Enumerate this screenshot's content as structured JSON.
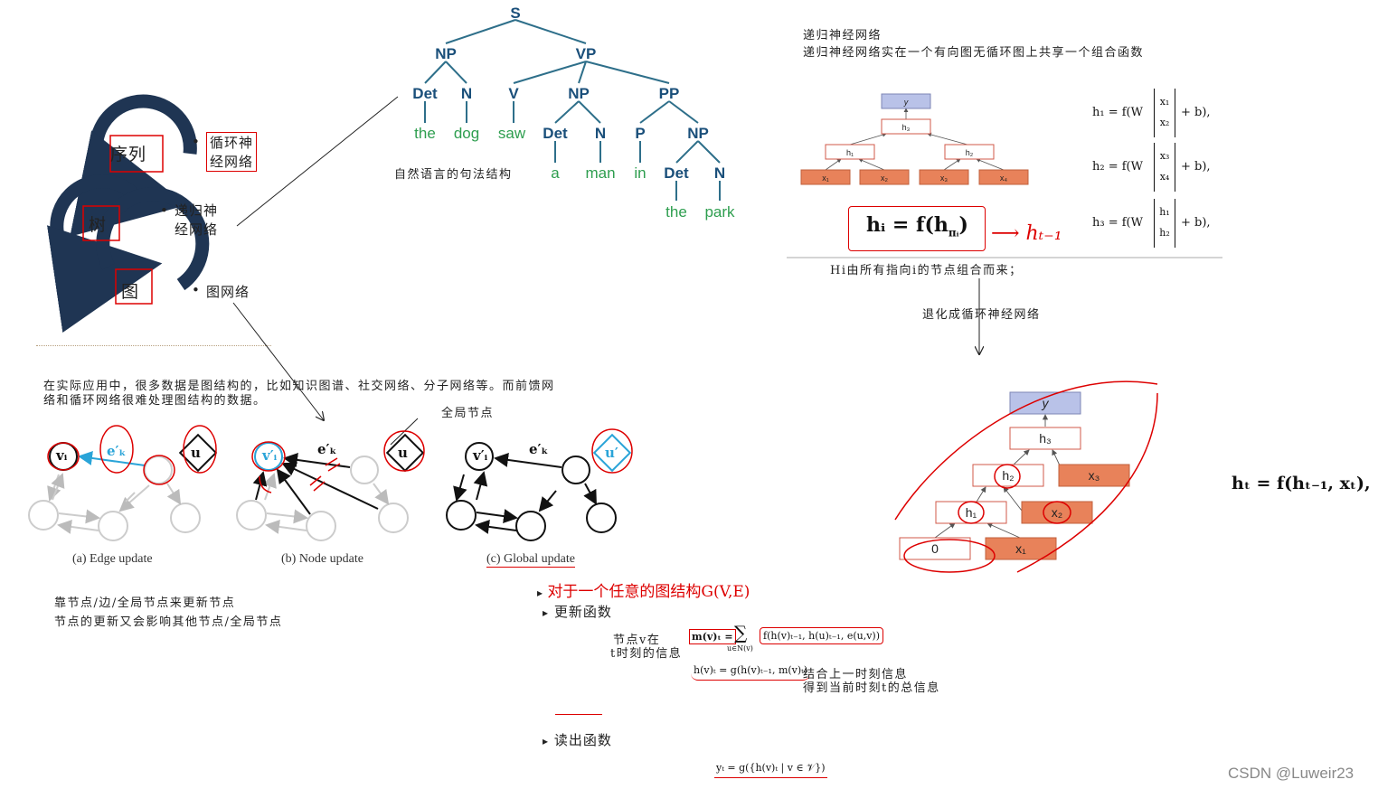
{
  "left_graphic": {
    "circle_labels": [
      "序列",
      "树",
      "图"
    ],
    "bullets": [
      {
        "label_l1": "循环神",
        "label_l2": "经网络"
      },
      {
        "label_l1": "递归神",
        "label_l2": "经网络"
      },
      {
        "label_l1": "图网络",
        "label_l2": ""
      }
    ],
    "dot": "•"
  },
  "parse_tree": {
    "nodes": [
      "S",
      "NP",
      "VP",
      "Det",
      "N",
      "V",
      "NP",
      "PP",
      "Det",
      "N",
      "P",
      "NP",
      "Det",
      "N"
    ],
    "words": [
      "the",
      "dog",
      "saw",
      "a",
      "man",
      "in",
      "the",
      "park"
    ],
    "caption": "自然语言的句法结构"
  },
  "recursive_nn": {
    "title": "递归神经网络",
    "desc": "递归神经网络实在一个有向图无循环图上共享一个组合函数",
    "node_labels": {
      "y": "y",
      "h3": "h₃",
      "h1": "h₁",
      "h2": "h₂",
      "x1": "x₁",
      "x2": "x₂",
      "x3": "x₃",
      "x4": "x₄"
    },
    "eq_lhs": [
      "h₁ = f(W",
      "h₂ = f(W",
      "h₃ = f(W"
    ],
    "eq_rhs": "+ b),",
    "vec_top": [
      "x₁",
      "x₃",
      "h₁"
    ],
    "vec_bot": [
      "x₂",
      "x₄",
      "h₂"
    ],
    "eq_main": "hᵢ = f(h",
    "eq_main_sub": "πᵢ",
    "eq_main_close": ")",
    "handwritten": "⟶ hₜ₋₁",
    "note": "Hi由所有指向i的节点组合而来；",
    "arrow_note": "退化成循环神经网络"
  },
  "rnn": {
    "node_labels": {
      "y": "y",
      "h3": "h₃",
      "h2": "h₂",
      "x3": "x₃",
      "h1": "h₁",
      "x2": "x₂",
      "zero": "0",
      "x1": "x₁"
    },
    "equation": "hₜ = f(hₜ₋₁, xₜ),"
  },
  "graph_text": {
    "intro_l1": "在实际应用中，很多数据是图结构的，比如知识图谱、社交网络、分子网络等。而前馈网",
    "intro_l2": "络和循环网络很难处理图结构的数据。",
    "global_node_note": "全局节点",
    "captions": [
      "(a) Edge update",
      "(b) Node update",
      "(c) Global update"
    ],
    "labels": {
      "vi": "vᵢ",
      "ek": "e′ₖ",
      "u": "u",
      "vi_p": "v′ᵢ",
      "u_p": "u′"
    },
    "note_l1": "靠节点/边/全局节点来更新节点",
    "note_l2": "节点的更新又会影响其他节点/全局节点"
  },
  "formulas": {
    "heading": "对于一个任意的图结构G(V,E)",
    "update_title": "更新函数",
    "node_info_l1": "节点v在",
    "node_info_l2": "t时刻的信息",
    "m_eq": "m(v)ₜ =",
    "sum": "∑",
    "sum_sub": "u∈N(v)",
    "f_args": "f(h(v)ₜ₋₁, h(u)ₜ₋₁, e(u,v))",
    "h_eq": "h(v)ₜ = g(h(v)ₜ₋₁, m(v)ₜ)",
    "combine_l1": "结合上一时刻信息",
    "combine_l2": "得到当前时刻t的总信息",
    "readout_title": "读出函数",
    "y_eq": "yₜ = g({h(v)ₜ | v ∈ 𝒱})",
    "marker": "▸"
  },
  "watermark": "CSDN @Luweir23",
  "colors": {
    "tree_nt": "#1a4f7a",
    "tree_word": "#2e9e4f",
    "red_ink": "#dd0000",
    "node_orange": "#e8825a",
    "node_blue": "#b9c2e8",
    "arc_navy": "#1f3553"
  }
}
